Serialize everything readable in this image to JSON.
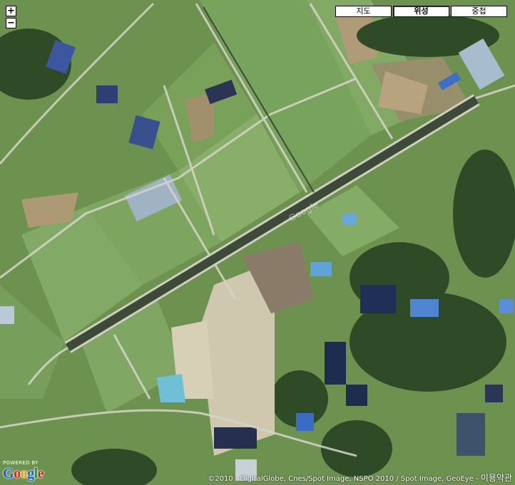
{
  "controls": {
    "zoom_in_label": "+",
    "zoom_out_label": "−"
  },
  "map_types": [
    {
      "label": "지도",
      "active": false
    },
    {
      "label": "위성",
      "active": true
    },
    {
      "label": "중첩",
      "active": false
    }
  ],
  "branding": {
    "powered_by": "POWERED BY",
    "logo_letters": [
      "G",
      "o",
      "o",
      "g",
      "l",
      "e"
    ]
  },
  "watermark": "Google",
  "attribution": {
    "text": "©2010 · DigitalGlobe, Cnes/Spot Image, NSPO 2010 / Spot Image, GeoEye - ",
    "terms_label": "이용약관"
  },
  "colors": {
    "field_green": "#6f9a54",
    "forest": "#2f4f28",
    "road": "#d8d8cc",
    "expressway": "#3f4a38"
  }
}
